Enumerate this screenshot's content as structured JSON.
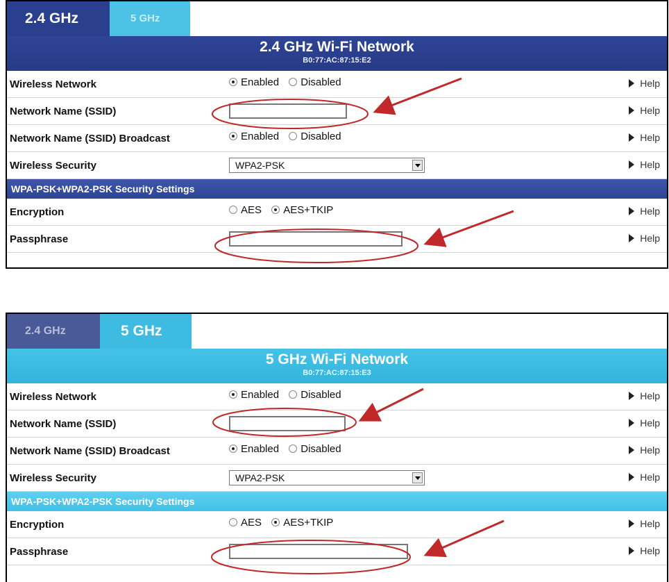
{
  "colors": {
    "dark_blue": "#2b3f8f",
    "light_blue": "#3dbbe0",
    "annotation_red": "#c0282a"
  },
  "panel_24": {
    "tab_active": "2.4 GHz",
    "tab_inactive": "5 GHz",
    "title": "2.4 GHz Wi-Fi Network",
    "mac": "B0:77:AC:87:15:E2",
    "rows": {
      "wireless_network": "Wireless Network",
      "ssid": "Network Name (SSID)",
      "broadcast": "Network Name (SSID) Broadcast",
      "security": "Wireless Security"
    },
    "section_title": "WPA-PSK+WPA2-PSK Security Settings",
    "encryption_label": "Encryption",
    "passphrase_label": "Passphrase",
    "security_value": "WPA2-PSK"
  },
  "panel_5": {
    "tab_inactive": "2.4 GHz",
    "tab_active": "5 GHz",
    "title": "5 GHz Wi-Fi Network",
    "mac": "B0:77:AC:87:15:E3",
    "rows": {
      "wireless_network": "Wireless Network",
      "ssid": "Network Name (SSID)",
      "broadcast": "Network Name (SSID) Broadcast",
      "security": "Wireless Security"
    },
    "section_title": "WPA-PSK+WPA2-PSK Security Settings",
    "encryption_label": "Encryption",
    "passphrase_label": "Passphrase",
    "security_value": "WPA2-PSK"
  },
  "options": {
    "enabled": "Enabled",
    "disabled": "Disabled",
    "aes": "AES",
    "aes_tkip": "AES+TKIP"
  },
  "help_label": "Help"
}
